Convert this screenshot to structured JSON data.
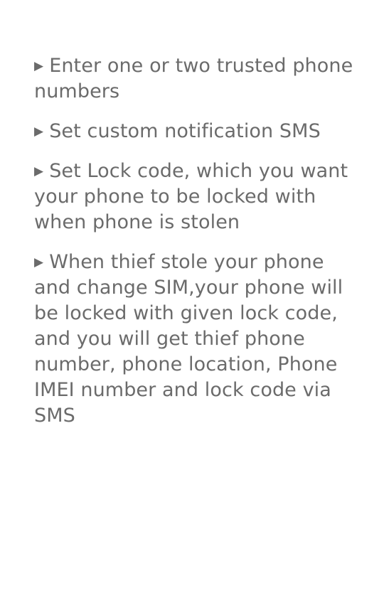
{
  "bullet_glyph": "▶",
  "items": [
    {
      "text": "Enter one or two trusted phone numbers"
    },
    {
      "text": "Set custom notification SMS"
    },
    {
      "text": "Set Lock code, which you want your phone to be locked with when phone is stolen"
    },
    {
      "text": "When thief stole your phone and change SIM,your phone will be locked with given lock code, and you will get thief phone number, phone location, Phone IMEI number and lock code via SMS"
    }
  ],
  "colors": {
    "text": "#6b6b6b",
    "background": "#ffffff"
  }
}
